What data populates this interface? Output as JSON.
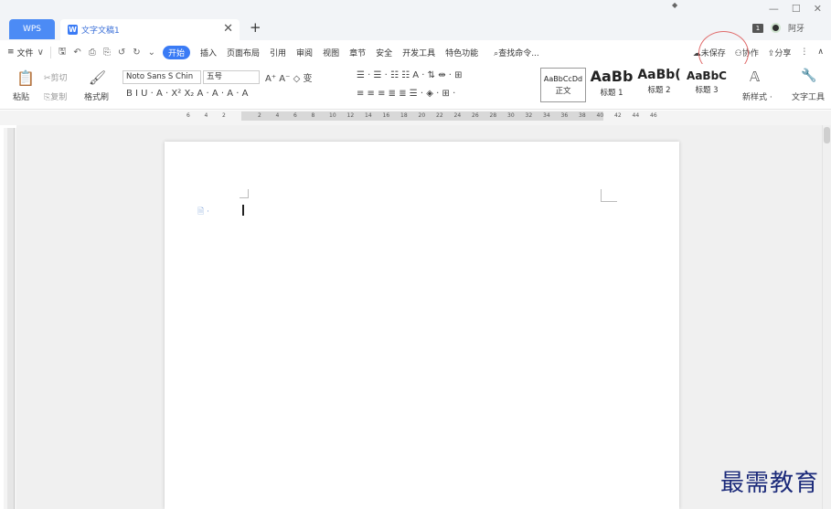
{
  "titlebar": {
    "wps_tab": "WPS",
    "doc_icon": "W",
    "doc_title": "文字文稿1",
    "close": "✕",
    "add": "+",
    "dot": "◆",
    "win_min": "—",
    "win_max": "☐",
    "win_close": "✕",
    "box_badge": "1",
    "user": "阿牙"
  },
  "menubar": {
    "menu_icon": "≡",
    "file": "文件",
    "quick": [
      "🖫",
      "↶",
      "⎙",
      "⎘",
      "↺",
      "↻",
      "⌄"
    ],
    "tabs": [
      "开始",
      "插入",
      "页面布局",
      "引用",
      "审阅",
      "视图",
      "章节",
      "安全",
      "开发工具",
      "特色功能"
    ],
    "search": "查找命令...",
    "unsaved": "未保存",
    "collab": "协作",
    "share": "分享",
    "more": "⋮",
    "collapse": "∧"
  },
  "ribbon": {
    "paste": "粘贴",
    "cut": "剪切",
    "copy": "复制",
    "format_painter": "格式刷",
    "font_name": "Noto Sans S Chin",
    "font_size": "五号",
    "font_ops": "A⁺ A⁻ ◇ 变",
    "text_fmt": "B  I  U ·  A ·  X²  X₂  A ·  A ·  A ·  A",
    "para_ops_1": "☰ · ☰ · ☷ ☷ A ·  ⇅  ⇹ ·  ⊞",
    "para_ops_2": "≡  ≡  ≡  ≣  ≣  ☰ ·  ◈ ·  ⊞ ·",
    "styles": [
      {
        "sample": "AaBbCcDd",
        "name": "正文"
      },
      {
        "sample": "AaBb",
        "name": "标题 1"
      },
      {
        "sample": "AaBb(",
        "name": "标题 2"
      },
      {
        "sample": "AaBbC",
        "name": "标题 3"
      }
    ],
    "new_style": "新样式 ·",
    "text_tools": "文字工具"
  },
  "ruler": {
    "ticks": [
      "6",
      "4",
      "2",
      "",
      "2",
      "4",
      "6",
      "8",
      "10",
      "12",
      "14",
      "16",
      "18",
      "20",
      "22",
      "24",
      "26",
      "28",
      "30",
      "32",
      "34",
      "36",
      "38",
      "40",
      "42",
      "44",
      "46"
    ]
  },
  "watermark": "最需教育"
}
